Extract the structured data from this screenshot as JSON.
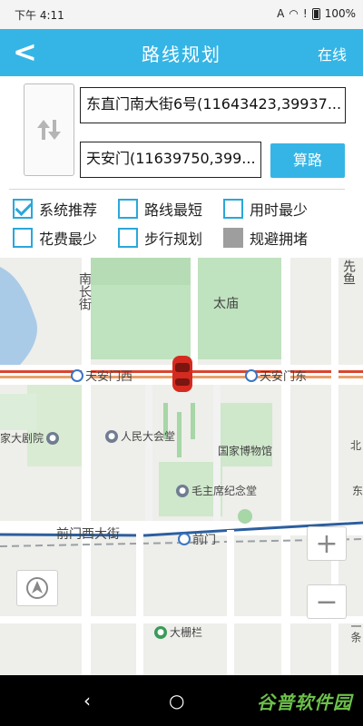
{
  "status_bar": {
    "time": "下午 4:11",
    "battery": "100%"
  },
  "header": {
    "back_icon": "chevron-left-icon",
    "title": "路线规划",
    "mode": "在线"
  },
  "route": {
    "from": "东直门南大街6号(11643423,39937...",
    "to": "天安门(11639750,399...",
    "calculate_label": "算路"
  },
  "options": [
    {
      "label": "系统推荐",
      "checked": true
    },
    {
      "label": "路线最短",
      "checked": false
    },
    {
      "label": "用时最少",
      "checked": false
    },
    {
      "label": "花费最少",
      "checked": false
    },
    {
      "label": "步行规划",
      "checked": false
    },
    {
      "label": "规避拥堵",
      "checked": false,
      "disabled": true
    }
  ],
  "map": {
    "labels": {
      "nanchang": "南长街",
      "taimiao": "太庙",
      "dajuyuan": "家大剧院",
      "dahall": "人民大会堂",
      "museum": "国家博物馆",
      "maomemorial": "毛主席纪念堂",
      "qianmenxidajie": "前门西大街",
      "dashilan": "大栅栏",
      "xianyu": "先鱼",
      "rightbei": "北",
      "rightdong": "东",
      "rightjin": "一条",
      "tiao": "条"
    },
    "metro": {
      "tam_west": "天安门西",
      "tam_east": "天安门东",
      "qianmen": "前门"
    }
  },
  "nav": {
    "back": "‹",
    "home": "○"
  },
  "watermark": "谷普软件园",
  "colors": {
    "accent": "#35b5e6",
    "route": "#c23b2b"
  }
}
